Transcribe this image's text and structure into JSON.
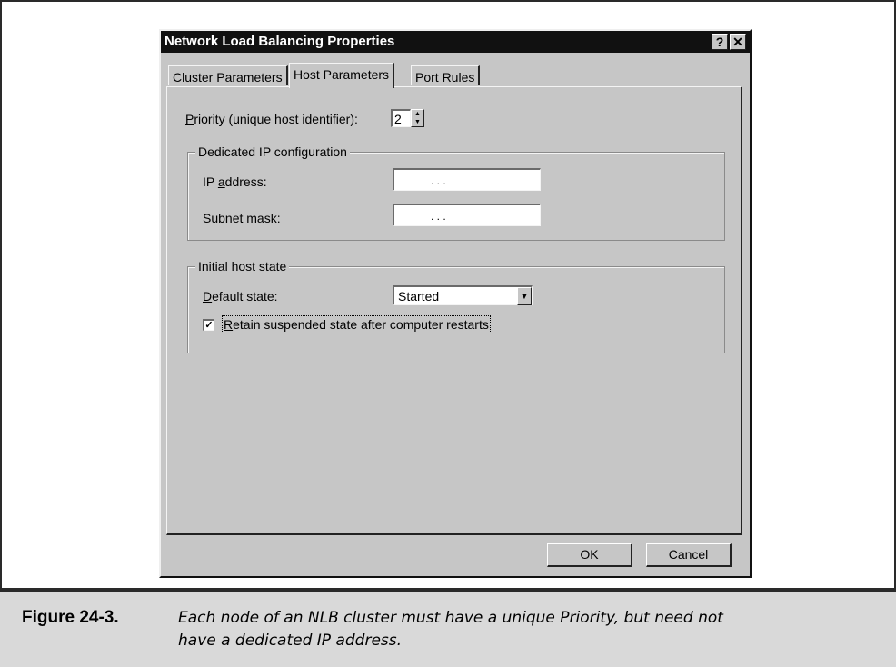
{
  "dialog": {
    "title": "Network Load Balancing Properties",
    "help_glyph": "?",
    "close_glyph": "✕"
  },
  "tabs": [
    {
      "label": "Cluster Parameters"
    },
    {
      "label": "Host Parameters",
      "selected": true
    },
    {
      "label": "Port Rules"
    }
  ],
  "priority": {
    "label_accel": "P",
    "label_rest": "riority (unique host identifier):",
    "value": "2"
  },
  "dedicated_ip": {
    "group_title": "Dedicated IP configuration",
    "ip_label_pre": "IP ",
    "ip_label_accel": "a",
    "ip_label_rest": "ddress:",
    "ip_value": ".       .       .",
    "subnet_label_accel": "S",
    "subnet_label_rest": "ubnet mask:",
    "subnet_value": ".       .       ."
  },
  "initial_state": {
    "group_title": "Initial host state",
    "default_label_accel": "D",
    "default_label_rest": "efault state:",
    "default_value": "Started",
    "retain_accel": "R",
    "retain_rest": "etain suspended state after computer restarts",
    "retain_checked": true,
    "check_glyph": "✓"
  },
  "buttons": {
    "ok": "OK",
    "cancel": "Cancel"
  },
  "caption": {
    "label": "Figure 24-3.",
    "text": "Each node of an NLB cluster must have a unique Priority, but need not have a dedicated IP address."
  }
}
